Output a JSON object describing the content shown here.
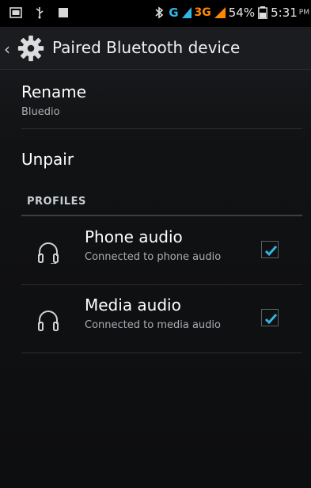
{
  "status_bar": {
    "network_g": "G",
    "network_3g": "3G",
    "battery_percent": "54%",
    "time": "5:31",
    "ampm": "PM"
  },
  "action_bar": {
    "title": "Paired Bluetooth device"
  },
  "rename": {
    "title": "Rename",
    "subtitle": "Bluedio"
  },
  "unpair": {
    "title": "Unpair"
  },
  "profiles": {
    "header": "PROFILES",
    "items": [
      {
        "title": "Phone audio",
        "subtitle": "Connected to phone audio",
        "checked": true
      },
      {
        "title": "Media audio",
        "subtitle": "Connected to media audio",
        "checked": true
      }
    ]
  },
  "colors": {
    "accent": "#33b5e5",
    "network_3g": "#ff8800"
  }
}
